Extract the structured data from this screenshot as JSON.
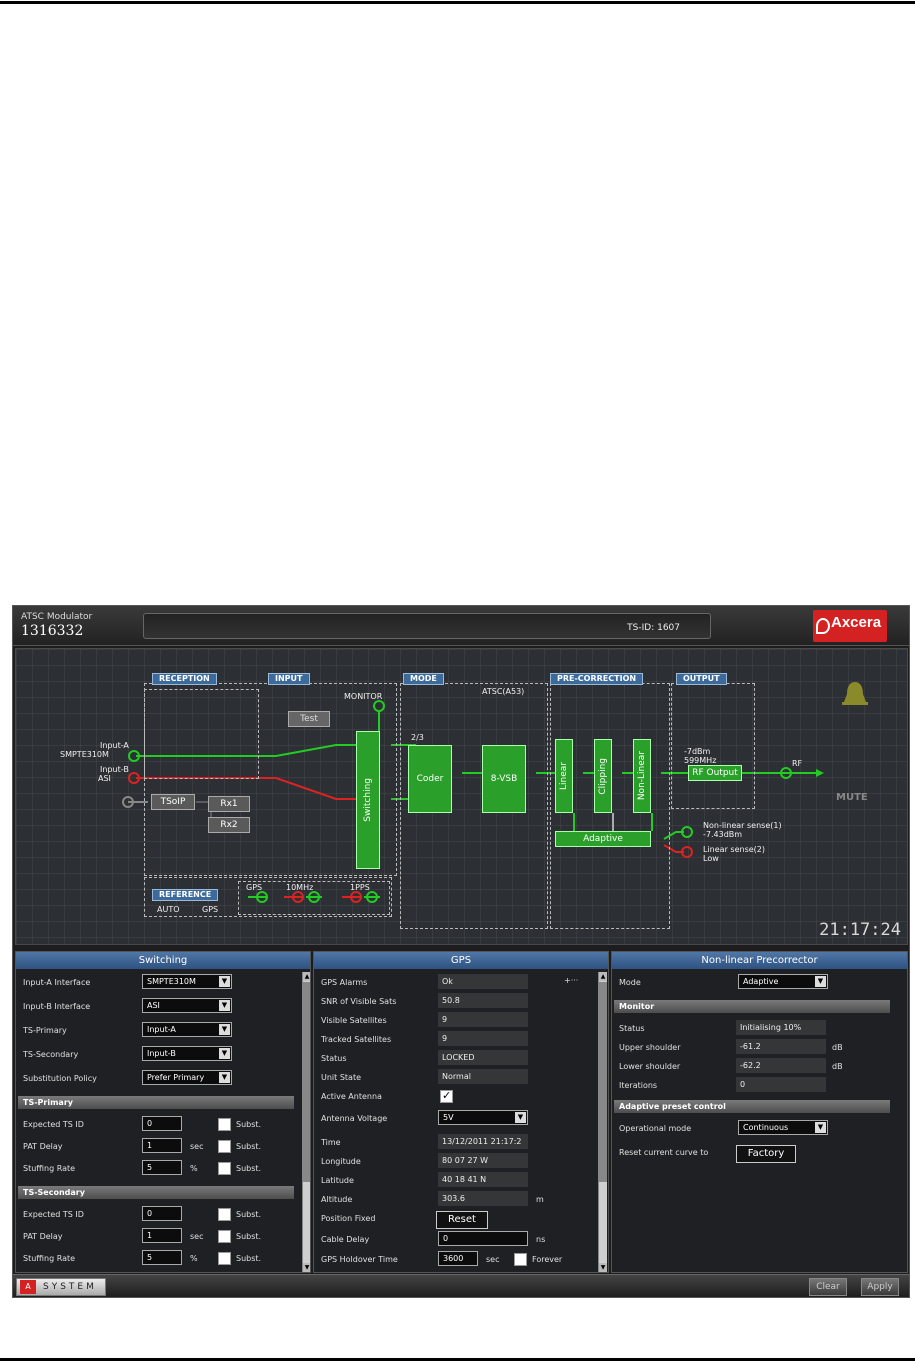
{
  "header": {
    "product_name": "ATSC Modulator",
    "serial": "1316332",
    "ts_id": "TS-ID: 1607",
    "logo_text": "Axcera"
  },
  "diagram": {
    "sections": {
      "reception": "RECEPTION",
      "input": "INPUT",
      "mode": "MODE",
      "precorrection": "PRE-CORRECTION",
      "output": "OUTPUT",
      "reference": "REFERENCE"
    },
    "test_label": "Test",
    "monitor_label": "MONITOR",
    "mode_name": "ATSC(A53)",
    "input_a_label": "Input-A",
    "input_a_type": "SMPTE310M",
    "input_b_label": "Input-B",
    "input_b_type": "ASI",
    "tsoip_label": "TSoIP",
    "rx1_label": "Rx1",
    "rx2_label": "Rx2",
    "switching_label": "Switching",
    "coder_rate": "2/3",
    "coder_label": "Coder",
    "vsb_label": "8-VSB",
    "linear_label": "Linear",
    "clipping_label": "Clipping",
    "nonlinear_label": "Non-Linear",
    "adaptive_label": "Adaptive",
    "output_level": "-7dBm",
    "output_freq": "599MHz",
    "rf_output_label": "RF Output",
    "rf_label": "RF",
    "mute_label": "MUTE",
    "nonlinear_sense": "Non-linear sense(1)",
    "nonlinear_sense_value": "-7.43dBm",
    "linear_sense": "Linear sense(2)",
    "linear_sense_value": "Low",
    "ref_auto": "AUTO",
    "ref_gps_label": "GPS",
    "gps_label": "GPS",
    "ten_mhz_label": "10MHz",
    "pps_label": "1PPS",
    "clock": "21:17:24",
    "colors": {
      "active": "#22cc22",
      "inactive": "#dd2222",
      "disabled": "#888888"
    }
  },
  "switching": {
    "title": "Switching",
    "rows": [
      {
        "label": "Input-A Interface",
        "value": "SMPTE310M"
      },
      {
        "label": "Input-B Interface",
        "value": "ASI"
      },
      {
        "label": "TS-Primary",
        "value": "Input-A"
      },
      {
        "label": "TS-Secondary",
        "value": "Input-B"
      },
      {
        "label": "Substitution Policy",
        "value": "Prefer Primary"
      }
    ],
    "primary": {
      "title": "TS-Primary",
      "expected_label": "Expected TS ID",
      "expected_value": "0",
      "pat_label": "PAT Delay",
      "pat_value": "1",
      "pat_unit": "sec",
      "stuffing_label": "Stuffing Rate",
      "stuffing_value": "5",
      "stuffing_unit": "%",
      "subst": "Subst."
    },
    "secondary": {
      "title": "TS-Secondary",
      "expected_label": "Expected TS ID",
      "expected_value": "0",
      "pat_label": "PAT Delay",
      "pat_value": "1",
      "pat_unit": "sec",
      "stuffing_label": "Stuffing Rate",
      "stuffing_value": "5",
      "stuffing_unit": "%",
      "subst": "Subst."
    }
  },
  "gps": {
    "title": "GPS",
    "alarms_label": "GPS Alarms",
    "alarms_value": "Ok",
    "more": "+···",
    "snr_label": "SNR of Visible Sats",
    "snr_value": "50.8",
    "visible_label": "Visible Satellites",
    "visible_value": "9",
    "tracked_label": "Tracked Satellites",
    "tracked_value": "9",
    "status_label": "Status",
    "status_value": "LOCKED",
    "unit_label": "Unit State",
    "unit_value": "Normal",
    "antenna_label": "Active Antenna",
    "voltage_label": "Antenna Voltage",
    "voltage_value": "5V",
    "time_label": "Time",
    "time_value": "13/12/2011 21:17:2",
    "longitude_label": "Longitude",
    "longitude_value": "80 07 27 W",
    "latitude_label": "Latitude",
    "latitude_value": "40 18 41 N",
    "altitude_label": "Altitude",
    "altitude_value": "303.6",
    "altitude_unit": "m",
    "position_label": "Position Fixed",
    "reset_label": "Reset",
    "cable_label": "Cable Delay",
    "cable_value": "0",
    "cable_unit": "ns",
    "holdover_label": "GPS Holdover Time",
    "holdover_value": "3600",
    "holdover_unit": "sec",
    "forever_label": "Forever"
  },
  "precorrector": {
    "title": "Non-linear Precorrector",
    "mode_label": "Mode",
    "mode_value": "Adaptive",
    "monitor_title": "Monitor",
    "status_label": "Status",
    "status_value": "Initialising 10%",
    "upper_label": "Upper shoulder",
    "upper_value": "-61.2",
    "upper_unit": "dB",
    "lower_label": "Lower shoulder",
    "lower_value": "-62.2",
    "lower_unit": "dB",
    "iter_label": "Iterations",
    "iter_value": "0",
    "preset_title": "Adaptive preset control",
    "opmode_label": "Operational mode",
    "opmode_value": "Continuous",
    "reset_curve_label": "Reset current curve to",
    "factory_label": "Factory"
  },
  "footer": {
    "system_label": "SYSTEM",
    "system_icon": "A",
    "clear_label": "Clear",
    "apply_label": "Apply"
  }
}
